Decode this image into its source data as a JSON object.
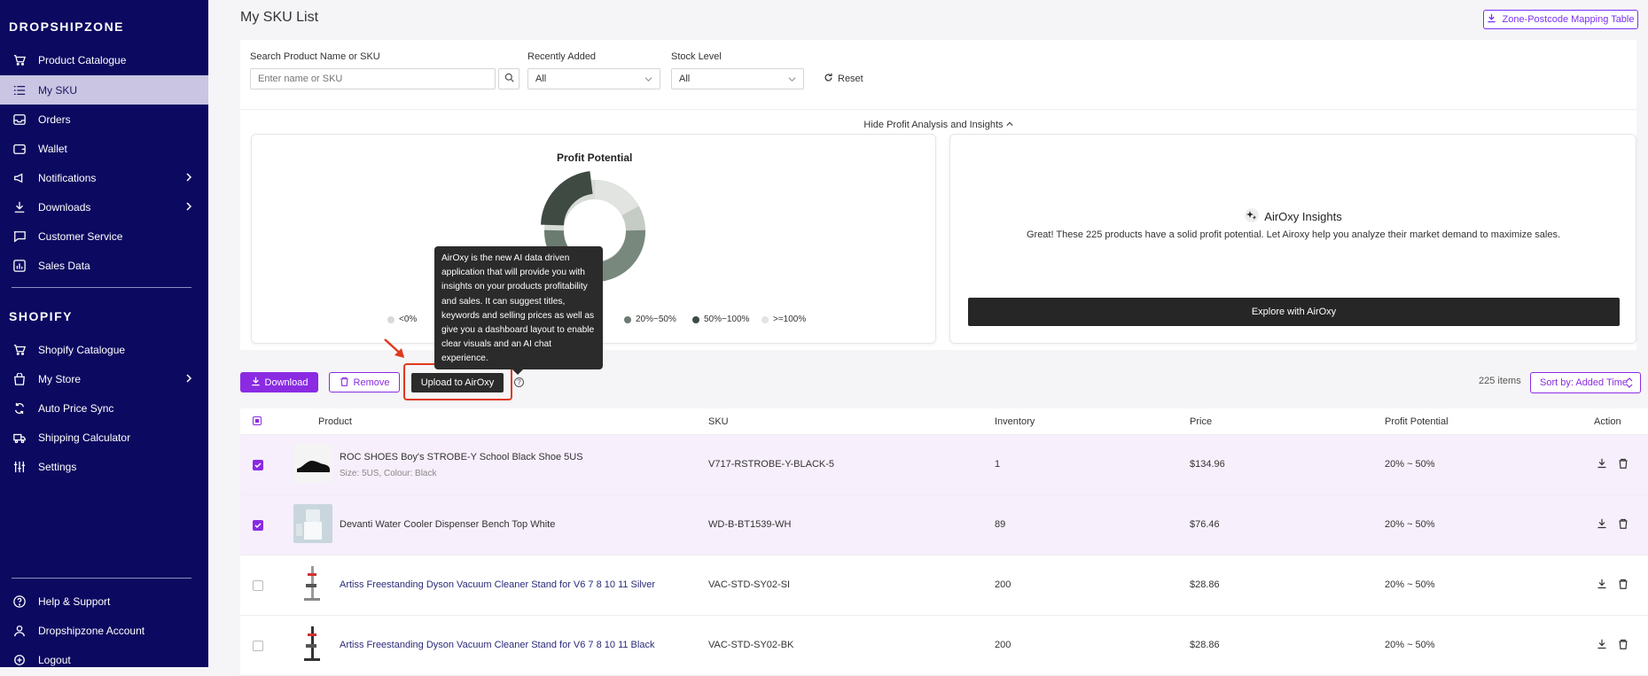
{
  "sidebar": {
    "brand": "DROPSHIPZONE",
    "items": [
      {
        "label": "Product Catalogue",
        "icon": "cart-icon"
      },
      {
        "label": "My SKU",
        "icon": "list-icon",
        "active": true
      },
      {
        "label": "Orders",
        "icon": "inbox-icon"
      },
      {
        "label": "Wallet",
        "icon": "wallet-icon"
      },
      {
        "label": "Notifications",
        "icon": "megaphone-icon",
        "chevron": true
      },
      {
        "label": "Downloads",
        "icon": "download-icon",
        "chevron": true
      },
      {
        "label": "Customer Service",
        "icon": "chat-icon"
      },
      {
        "label": "Sales Data",
        "icon": "chart-icon"
      }
    ],
    "shopify_heading": "SHOPIFY",
    "shopify_items": [
      {
        "label": "Shopify Catalogue",
        "icon": "cart-icon"
      },
      {
        "label": "My Store",
        "icon": "bag-icon",
        "chevron": true
      },
      {
        "label": "Auto Price Sync",
        "icon": "sync-icon"
      },
      {
        "label": "Shipping Calculator",
        "icon": "truck-icon"
      },
      {
        "label": "Settings",
        "icon": "sliders-icon"
      }
    ],
    "bottom_items": [
      {
        "label": "Help & Support",
        "icon": "help-icon"
      },
      {
        "label": "Dropshipzone Account",
        "icon": "user-icon"
      },
      {
        "label": "Logout",
        "icon": "logout-icon"
      }
    ]
  },
  "header": {
    "title": "My SKU List",
    "zone_button": "Zone-Postcode Mapping Table"
  },
  "filters": {
    "search_label": "Search Product Name or SKU",
    "search_placeholder": "Enter name or SKU",
    "recent_label": "Recently Added",
    "recent_value": "All",
    "stock_label": "Stock Level",
    "stock_value": "All",
    "reset": "Reset",
    "hide_link": "Hide Profit Analysis and Insights"
  },
  "profit_card": {
    "title": "Profit Potential",
    "legend": [
      {
        "label": "<0%",
        "color": "#d9d9d9"
      },
      {
        "label": "20%~50%",
        "color": "#6b7b70"
      },
      {
        "label": "50%~100%",
        "color": "#3e4a42"
      },
      {
        "label": ">=100%",
        "color": "#e3e3e3"
      }
    ]
  },
  "insights": {
    "title": "AirOxy Insights",
    "text": "Great! These 225 products have a solid profit potential. Let Airoxy help you analyze their market demand to maximize sales.",
    "button": "Explore with AirOxy"
  },
  "tooltip": "AirOxy is the new AI data driven application that will provide you with insights on your products profitability and sales. It can suggest titles, keywords and selling prices as well as give you a dashboard layout to enable clear visuals and an AI chat experience.",
  "toolbar": {
    "download": "Download",
    "remove": "Remove",
    "upload": "Upload to AirOxy",
    "items": "225 items",
    "sort": "Sort by: Added Time"
  },
  "table": {
    "headers": [
      "Product",
      "SKU",
      "Inventory",
      "Price",
      "Profit Potential",
      "Action"
    ],
    "rows": [
      {
        "name": "ROC SHOES Boy's STROBE-Y School Black Shoe 5US",
        "variant": "Size: 5US, Colour: Black",
        "sku": "V717-RSTROBE-Y-BLACK-5",
        "inventory": "1",
        "price": "$134.96",
        "profit": "20% ~ 50%",
        "checked": true
      },
      {
        "name": "Devanti Water Cooler Dispenser Bench Top White",
        "variant": "",
        "sku": "WD-B-BT1539-WH",
        "inventory": "89",
        "price": "$76.46",
        "profit": "20% ~ 50%",
        "checked": true
      },
      {
        "name": "Artiss Freestanding Dyson Vacuum Cleaner Stand for V6 7 8 10 11 Silver",
        "variant": "",
        "sku": "VAC-STD-SY02-SI",
        "inventory": "200",
        "price": "$28.86",
        "profit": "20% ~ 50%",
        "checked": false
      },
      {
        "name": "Artiss Freestanding Dyson Vacuum Cleaner Stand for V6 7 8 10 11 Black",
        "variant": "",
        "sku": "VAC-STD-SY02-BK",
        "inventory": "200",
        "price": "$28.86",
        "profit": "20% ~ 50%",
        "checked": false
      }
    ]
  }
}
